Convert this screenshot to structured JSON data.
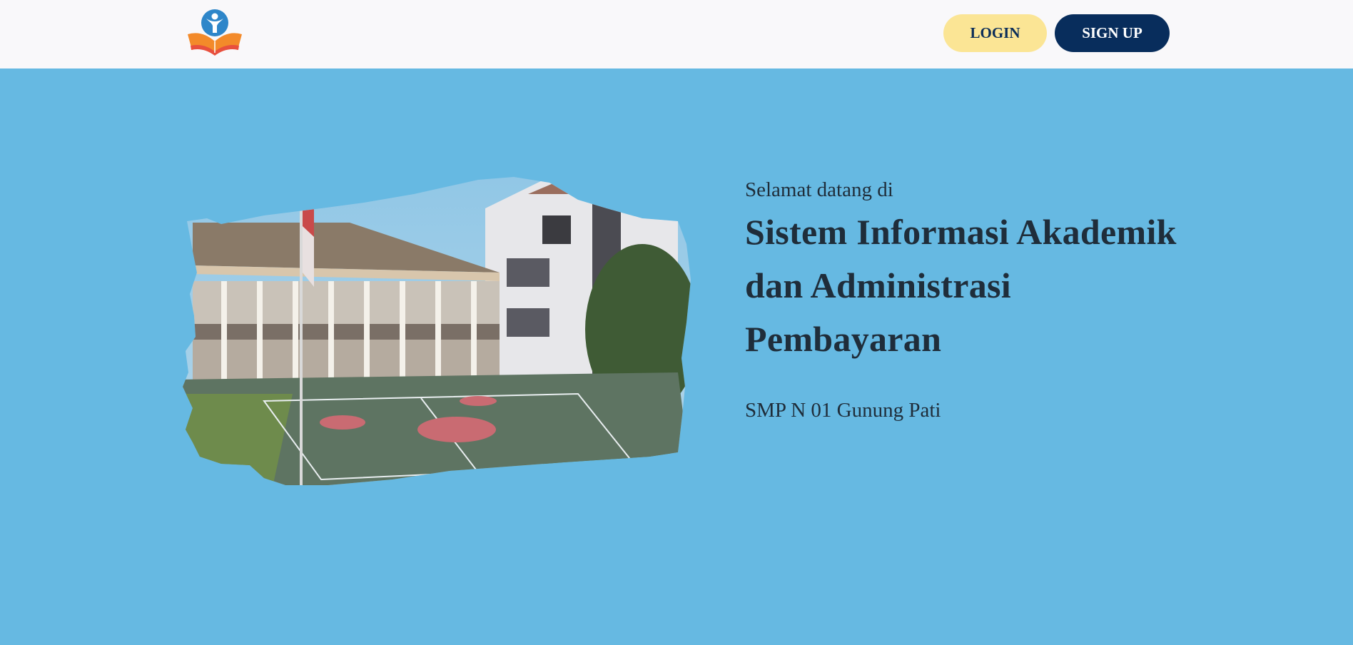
{
  "navbar": {
    "logo": {
      "icon": "book-person-logo-icon"
    },
    "login_label": "LOGIN",
    "signup_label": "SIGN UP"
  },
  "colors": {
    "background": "#66b9e2",
    "navbar": "#f9f8fa",
    "login_button": "#fbe595",
    "signup_button": "#082d5c",
    "text_dark": "#1f2d3a"
  },
  "hero": {
    "image": {
      "icon": "school-building-photo"
    },
    "welcome": "Selamat datang di",
    "title_line1": "Sistem Informasi Akademik",
    "title_line2": "dan Administrasi",
    "title_line3": "Pembayaran",
    "school_name": "SMP N 01 Gunung Pati"
  }
}
